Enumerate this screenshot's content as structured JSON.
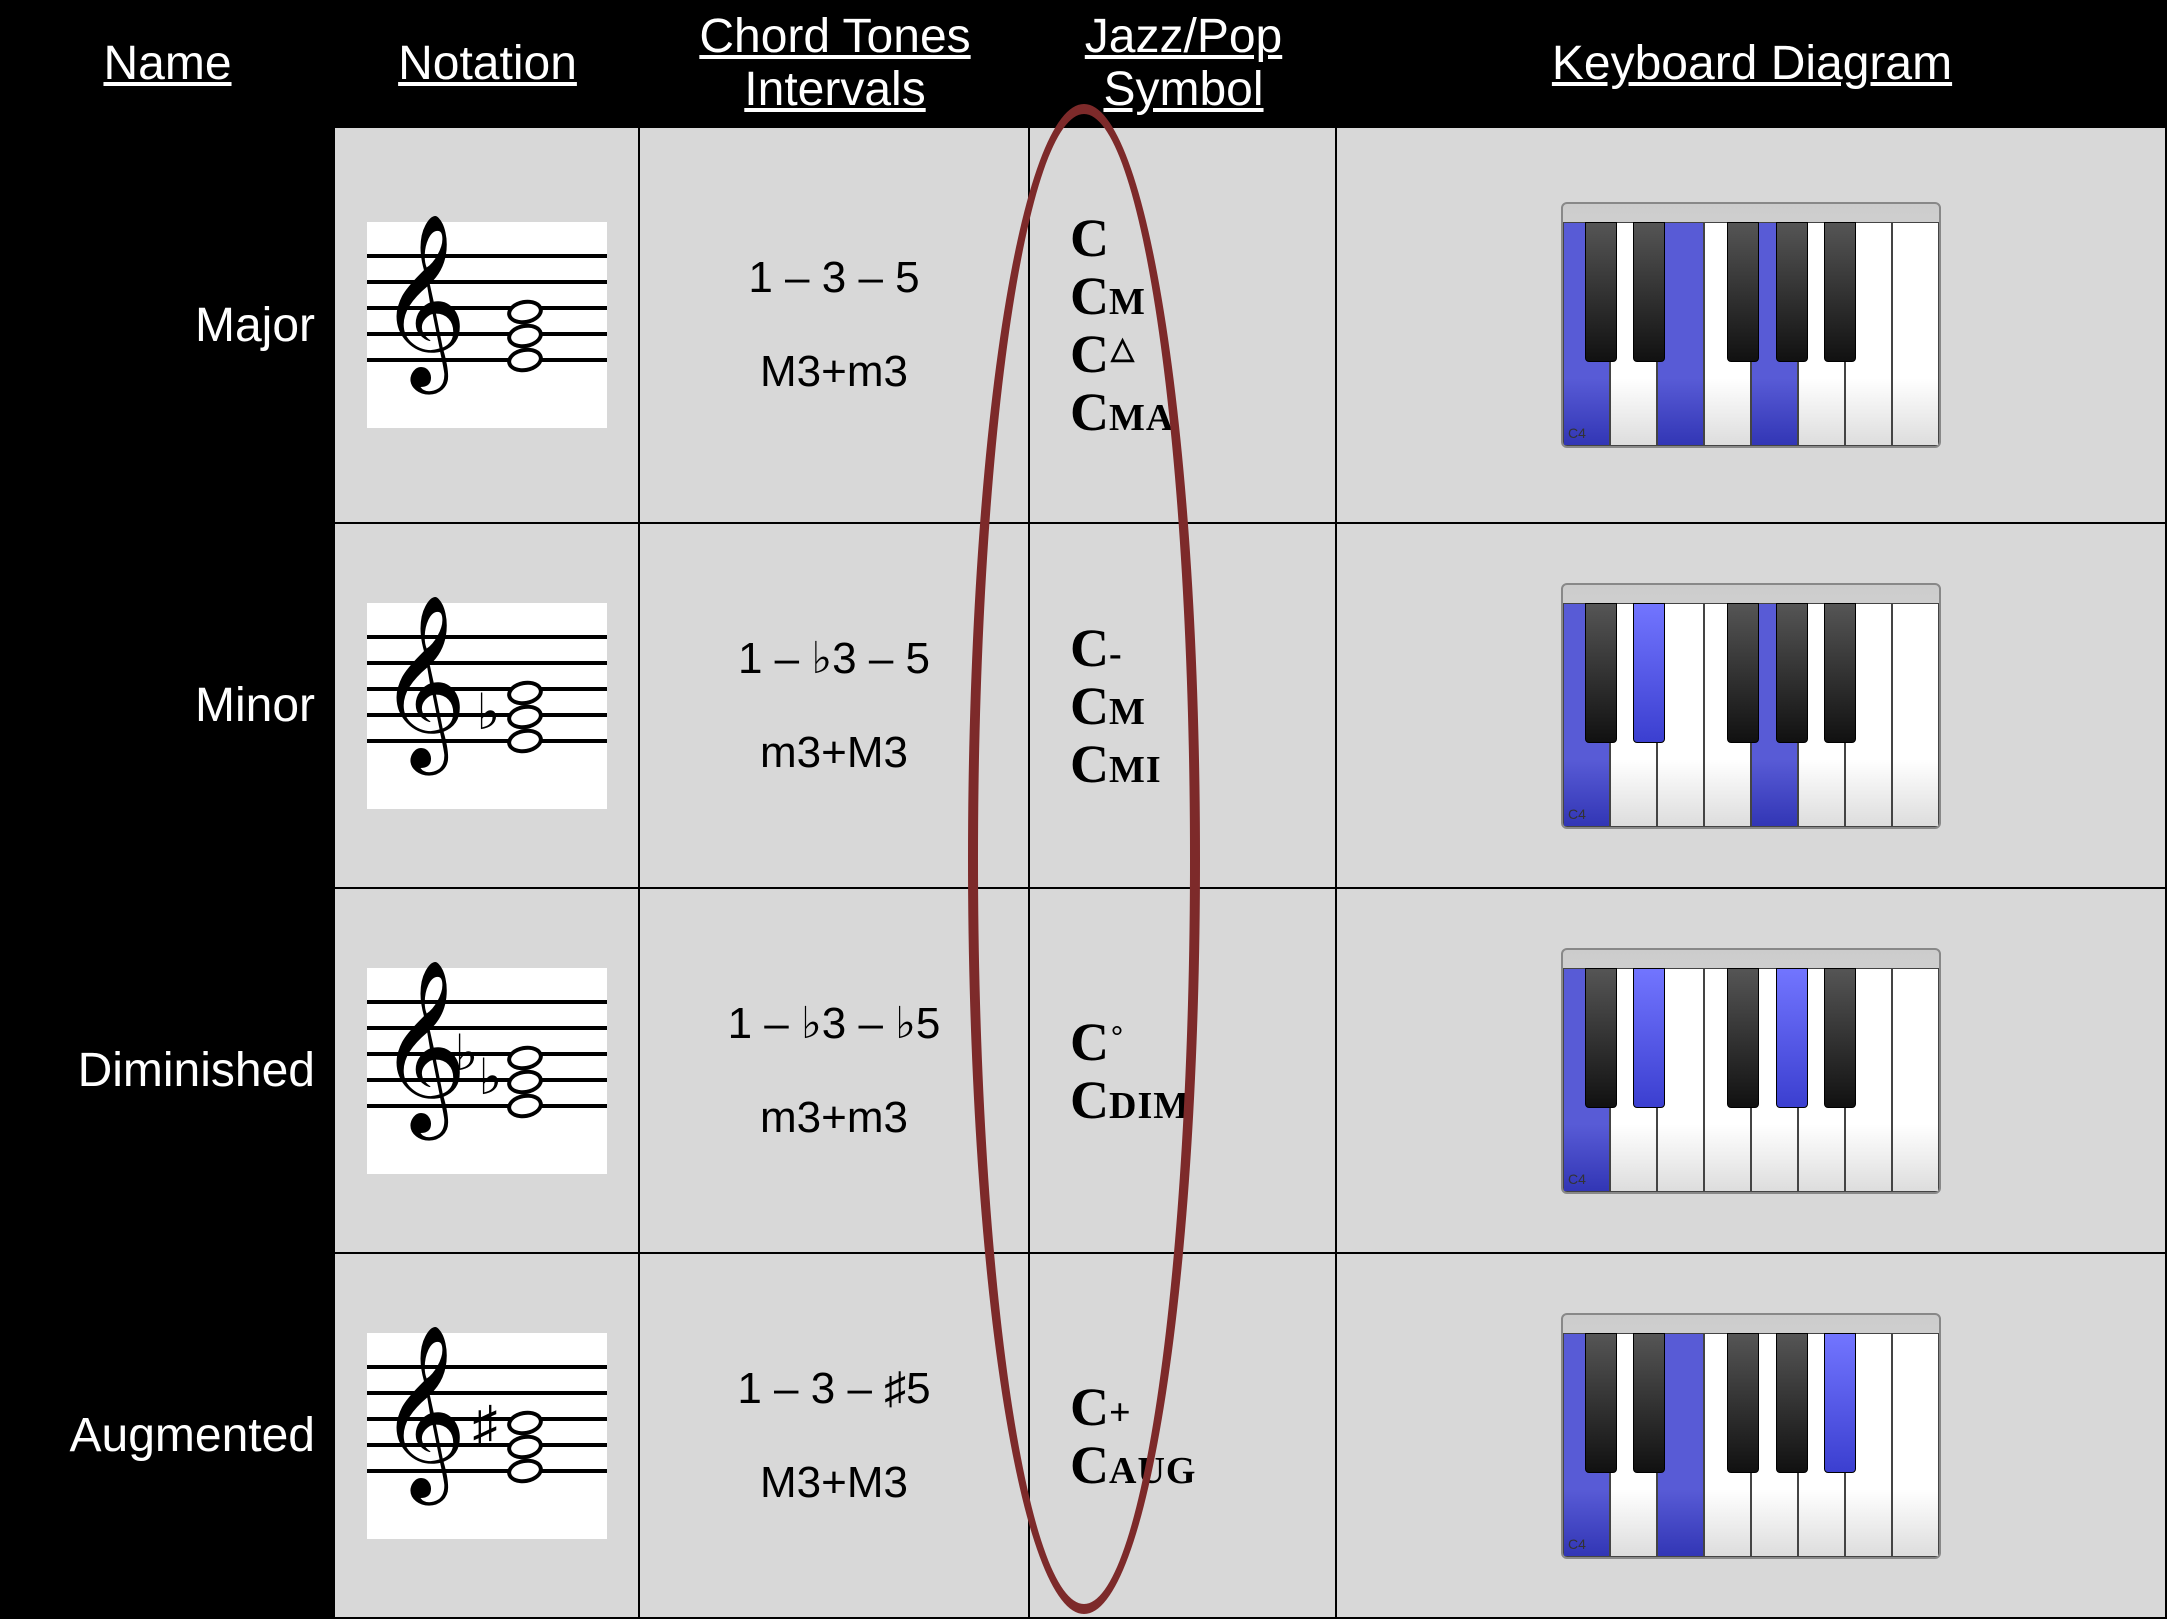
{
  "columns": [
    "Name",
    "Notation",
    "Chord Tones\nIntervals",
    "Jazz/Pop\nSymbol",
    "Keyboard Diagram"
  ],
  "chart_data": {
    "type": "table",
    "rows": [
      {
        "name": "Major",
        "chord_tones": "1 – 3 – 5",
        "interval_formula": "M3+m3",
        "jazz_symbols": [
          "C",
          "CM",
          "C△",
          "CMA"
        ],
        "notation": {
          "root": "C",
          "accidentals": []
        },
        "keyboard": {
          "highlighted_white": [
            0,
            2,
            4
          ],
          "highlighted_black": [],
          "c4_index": 0
        }
      },
      {
        "name": "Minor",
        "chord_tones": "1 – ♭3 – 5",
        "interval_formula": "m3+M3",
        "jazz_symbols": [
          "C-",
          "CM",
          "CMI"
        ],
        "notation": {
          "root": "C",
          "accidentals": [
            "flat-3"
          ]
        },
        "keyboard": {
          "highlighted_white": [
            0,
            4
          ],
          "highlighted_black": [
            1
          ],
          "c4_index": 0
        }
      },
      {
        "name": "Diminished",
        "chord_tones": "1 – ♭3 – ♭5",
        "interval_formula": "m3+m3",
        "jazz_symbols": [
          "C°",
          "CDIM"
        ],
        "notation": {
          "root": "C",
          "accidentals": [
            "flat-3",
            "flat-5"
          ]
        },
        "keyboard": {
          "highlighted_white": [
            0
          ],
          "highlighted_black": [
            1,
            3
          ],
          "c4_index": 0
        }
      },
      {
        "name": "Augmented",
        "chord_tones": "1 – 3 – ♯5",
        "interval_formula": "M3+M3",
        "jazz_symbols": [
          "C+",
          "CAUG"
        ],
        "notation": {
          "root": "C",
          "accidentals": [
            "sharp-5"
          ]
        },
        "keyboard": {
          "highlighted_white": [
            0,
            2
          ],
          "highlighted_black": [
            4
          ],
          "c4_index": 0
        }
      }
    ]
  },
  "keyboard_meta": {
    "white_keys": 8,
    "black_positions_pct": [
      10.2,
      23.0,
      48.0,
      60.8,
      73.6
    ],
    "c4_label": "C4"
  },
  "annotation": {
    "ellipse_column": "Jazz/Pop Symbol"
  }
}
